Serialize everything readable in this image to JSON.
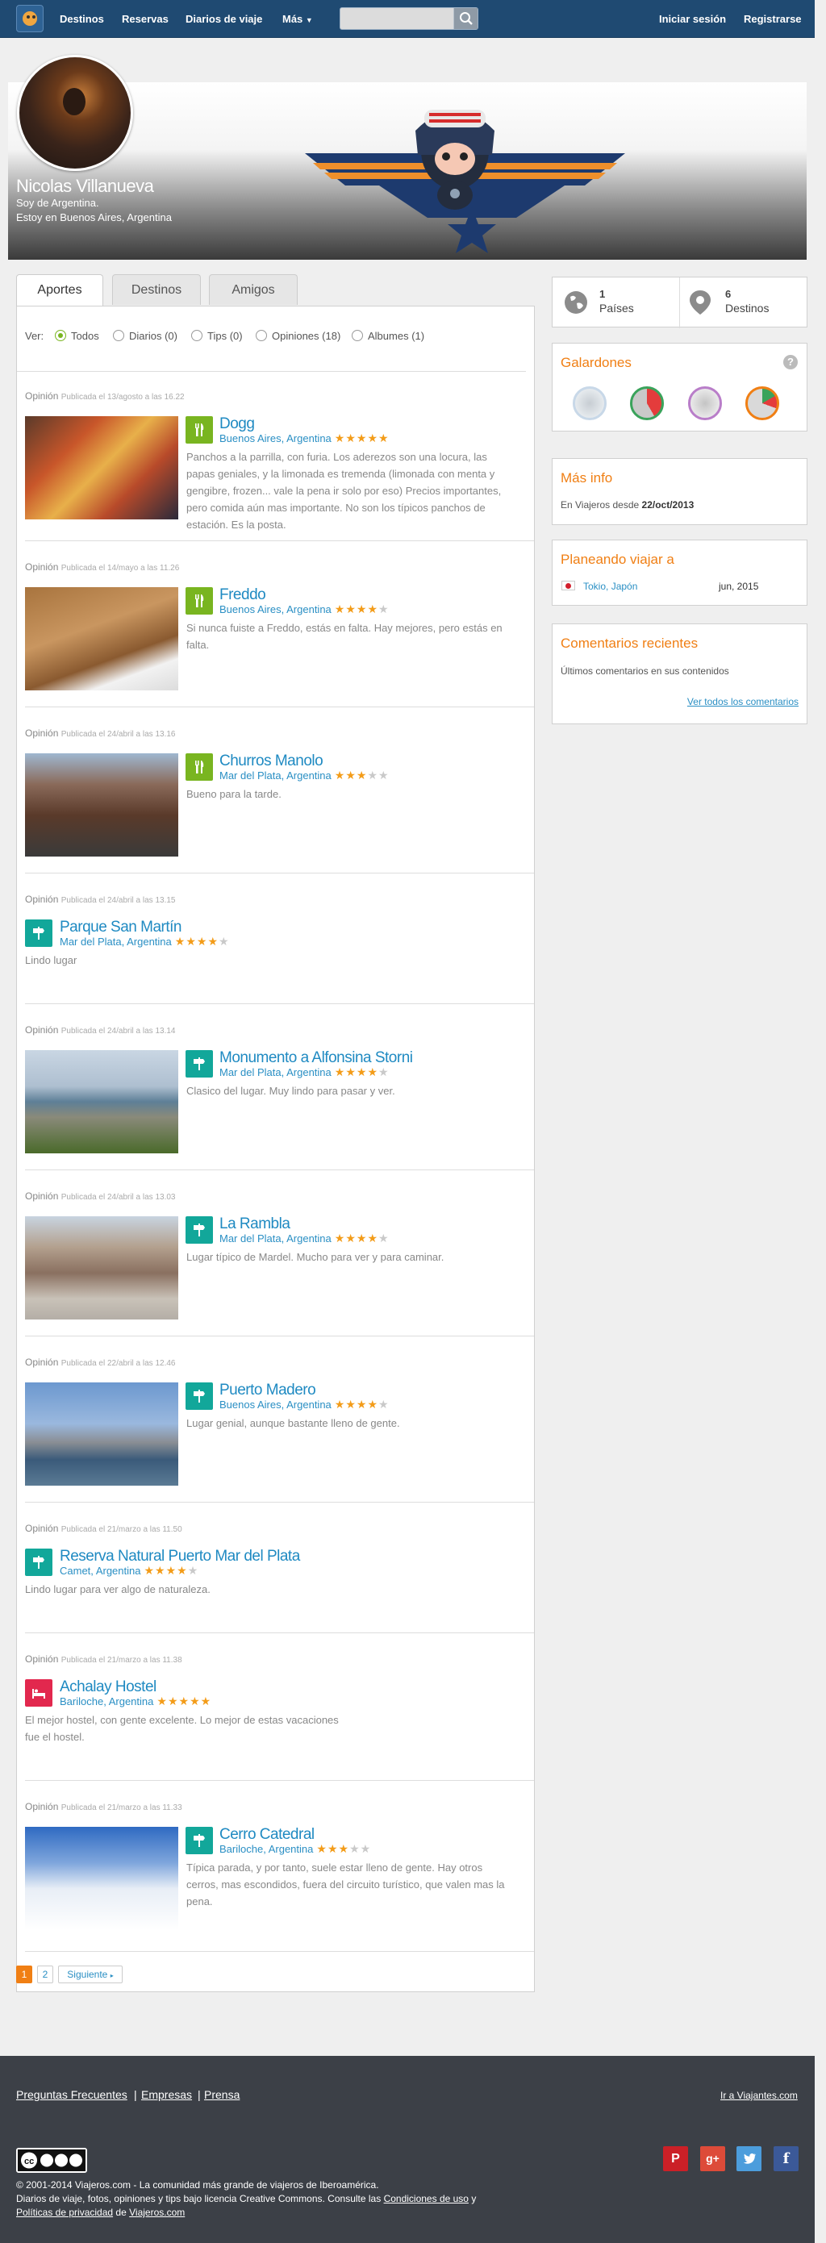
{
  "nav": {
    "destinos": "Destinos",
    "reservas": "Reservas",
    "diarios": "Diarios de viaje",
    "mas": "Más",
    "login": "Iniciar sesión",
    "register": "Registrarse",
    "search_placeholder": ""
  },
  "profile": {
    "name": "Nicolas Villanueva",
    "line1": "Soy de Argentina.",
    "line2": "Estoy en Buenos Aires, Argentina"
  },
  "tabs": [
    "Aportes",
    "Destinos",
    "Amigos"
  ],
  "filters": {
    "label": "Ver:",
    "options": [
      "Todos",
      "Diarios (0)",
      "Tips (0)",
      "Opiniones (18)",
      "Albumes (1)"
    ],
    "selected": "Todos"
  },
  "entries": [
    {
      "type": "Opinión",
      "date": "Publicada el 13/agosto a las 16.22",
      "title": "Dogg",
      "city": "Buenos Aires",
      "country": "Argentina",
      "rating": 5,
      "category": "restaurant",
      "text": "Panchos a la parrilla, con furia. Los aderezos son una locura, las papas geniales, y la limonada es tremenda (limonada con menta y gengibre, frozen... vale la pena ir solo por eso) Precios importantes, pero comida aún mas importante. No son los típicos panchos de estación. Es la posta.",
      "has_photo": true
    },
    {
      "type": "Opinión",
      "date": "Publicada el 14/mayo a las 11.26",
      "title": "Freddo",
      "city": "Buenos Aires",
      "country": "Argentina",
      "rating": 4,
      "category": "restaurant",
      "text": "Si nunca fuiste a Freddo, estás en falta. Hay mejores, pero estás en falta.",
      "has_photo": true
    },
    {
      "type": "Opinión",
      "date": "Publicada el 24/abril a las 13.16",
      "title": "Churros Manolo",
      "city": "Mar del Plata",
      "country": "Argentina",
      "rating": 3,
      "category": "restaurant",
      "text": "Bueno para la tarde.",
      "has_photo": true
    },
    {
      "type": "Opinión",
      "date": "Publicada el 24/abril a las 13.15",
      "title": "Parque San Martín",
      "city": "Mar del Plata",
      "country": "Argentina",
      "rating": 4,
      "category": "attraction",
      "text": "Lindo lugar",
      "has_photo": false
    },
    {
      "type": "Opinión",
      "date": "Publicada el 24/abril a las 13.14",
      "title": "Monumento a Alfonsina Storni",
      "city": "Mar del Plata",
      "country": "Argentina",
      "rating": 4,
      "category": "attraction",
      "text": "Clasico del lugar. Muy lindo para pasar y ver.",
      "has_photo": true
    },
    {
      "type": "Opinión",
      "date": "Publicada el 24/abril a las 13.03",
      "title": "La Rambla",
      "city": "Mar del Plata",
      "country": "Argentina",
      "rating": 4,
      "category": "attraction",
      "text": "Lugar típico de Mardel. Mucho para ver y para caminar.",
      "has_photo": true
    },
    {
      "type": "Opinión",
      "date": "Publicada el 22/abril a las 12.46",
      "title": "Puerto Madero",
      "city": "Buenos Aires",
      "country": "Argentina",
      "rating": 4,
      "category": "attraction",
      "text": "Lugar genial, aunque bastante lleno de gente.",
      "has_photo": true
    },
    {
      "type": "Opinión",
      "date": "Publicada el 21/marzo a las 11.50",
      "title": "Reserva Natural Puerto Mar del Plata",
      "city": "Camet",
      "country": "Argentina",
      "rating": 4,
      "category": "attraction",
      "text": "Lindo lugar para ver algo de naturaleza.",
      "has_photo": false
    },
    {
      "type": "Opinión",
      "date": "Publicada el 21/marzo a las 11.38",
      "title": "Achalay Hostel",
      "city": "Bariloche",
      "country": "Argentina",
      "rating": 5,
      "category": "hotel",
      "text": "El mejor hostel, con gente excelente. Lo mejor de estas vacaciones fue el hostel.",
      "has_photo": false
    },
    {
      "type": "Opinión",
      "date": "Publicada el 21/marzo a las 11.33",
      "title": "Cerro Catedral",
      "city": "Bariloche",
      "country": "Argentina",
      "rating": 3,
      "category": "attraction",
      "text": "Típica parada, y por tanto, suele estar lleno de gente. Hay otros cerros, mas escondidos, fuera del circuito turístico, que valen mas la pena.",
      "has_photo": true
    }
  ],
  "pager": {
    "pages": [
      "1",
      "2"
    ],
    "current": "1",
    "next": "Siguiente"
  },
  "stats": {
    "paises_count": "1",
    "paises_label": "Países",
    "destinos_count": "6",
    "destinos_label": "Destinos"
  },
  "galardones": {
    "title": "Galardones",
    "help": "?"
  },
  "mas_info": {
    "title": "Más info",
    "text": "En Viajeros desde",
    "since": "22/oct/2013"
  },
  "planeando": {
    "title": "Planeando viajar a",
    "city": "Tokio",
    "country": "Japón",
    "date": "jun, 2015"
  },
  "comentarios": {
    "title": "Comentarios recientes",
    "text": "Últimos comentarios en sus contenidos",
    "link": "Ver todos los comentarios"
  },
  "footer": {
    "faq": "Preguntas Frecuentes",
    "empresas": "Empresas",
    "prensa": "Prensa",
    "viajantes": "Ir a Viajantes.com",
    "copyright": "© 2001-2014 Viajeros.com - La comunidad más grande de viajeros de Iberoamérica.",
    "license_pre": "Diarios de viaje, fotos, opiniones y tips bajo licencia Creative Commons. Consulte las",
    "terms": "Condiciones de uso",
    "and": "y",
    "privacy": "Políticas de privacidad",
    "de": "de",
    "site": "Viajeros.com"
  },
  "colors": {
    "header": "#1f4a72",
    "accent": "#f07f14",
    "link": "#1f8ac2",
    "restaurant": "#79b520",
    "attraction": "#12a79a",
    "hotel": "#e2284e",
    "star": "#f39c19"
  },
  "icons": {
    "search": "search-icon",
    "restaurant": "fork-knife-icon",
    "attraction": "signpost-icon",
    "hotel": "bed-icon",
    "globe": "globe-icon",
    "pin": "map-pin-icon"
  }
}
